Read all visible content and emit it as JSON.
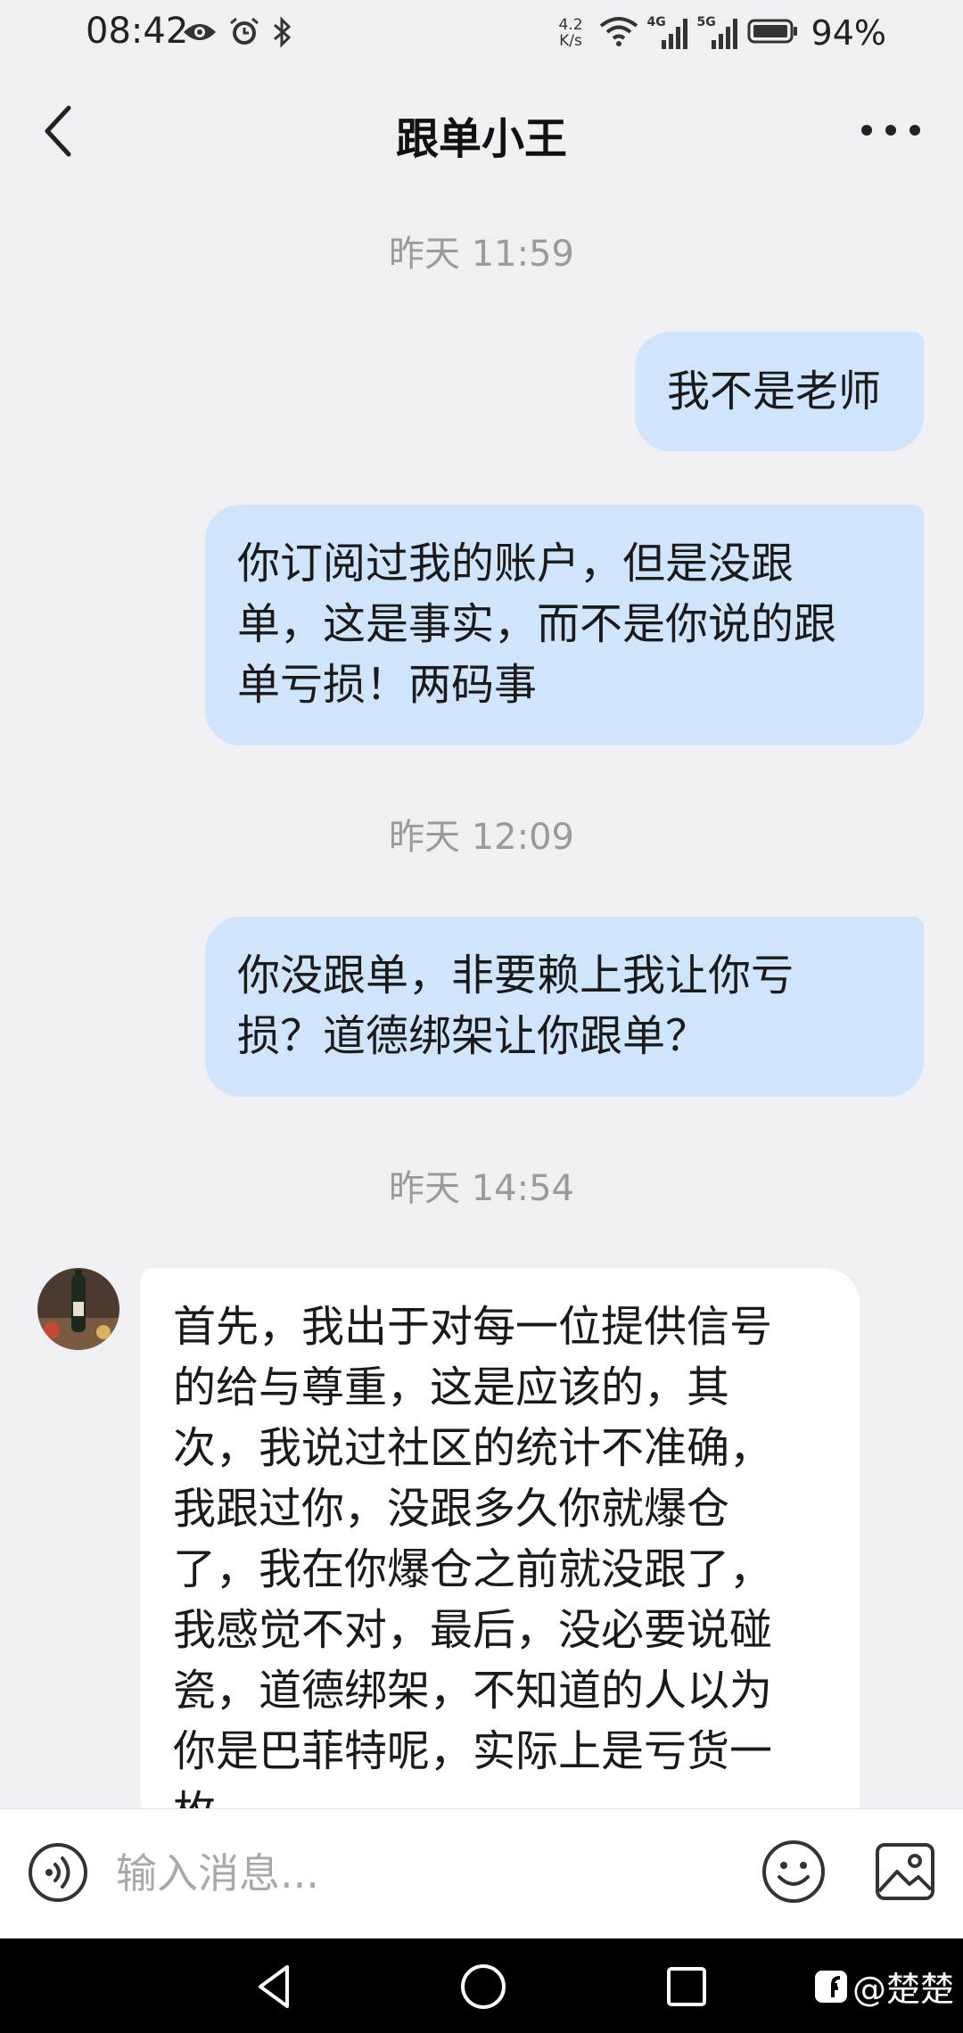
{
  "status_bar": {
    "time": "08:42",
    "net_speed_value": "4.2",
    "net_speed_unit": "K/s",
    "net_4g": "4G",
    "net_5g": "5G",
    "battery": "94%",
    "icons": [
      "eye-icon",
      "alarm-icon",
      "bluetooth-icon",
      "wifi-icon",
      "signal-icon",
      "battery-icon"
    ]
  },
  "header": {
    "title": "跟单小王",
    "icons": [
      "back-icon",
      "more-icon"
    ]
  },
  "messages": [
    {
      "type": "timestamp",
      "text": "昨天 11:59"
    },
    {
      "type": "out",
      "lines": [
        "我不是老师"
      ]
    },
    {
      "type": "out",
      "lines": [
        "你订阅过我的账户，但是没跟",
        "单，这是事实，而不是你说的跟",
        "单亏损！两码事"
      ]
    },
    {
      "type": "timestamp",
      "text": "昨天 12:09"
    },
    {
      "type": "out",
      "lines": [
        "你没跟单，非要赖上我让你亏",
        "损？道德绑架让你跟单？"
      ]
    },
    {
      "type": "timestamp",
      "text": "昨天 14:54"
    },
    {
      "type": "in",
      "lines": [
        "首先，我出于对每一位提供信号",
        "的给与尊重，这是应该的，其",
        "次，我说过社区的统计不准确，",
        "我跟过你，没跟多久你就爆仓",
        "了，我在你爆仓之前就没跟了，",
        "我感觉不对，最后，没必要说碰",
        "瓷，道德绑架，不知道的人以为",
        "你是巴菲特呢，实际上是亏货一",
        "枚"
      ]
    }
  ],
  "input_bar": {
    "placeholder": "输入消息...",
    "icons": [
      "voice-icon",
      "emoji-icon",
      "image-icon"
    ]
  },
  "nav_bar": {
    "icons": [
      "nav-back-icon",
      "nav-home-icon",
      "nav-recent-icon"
    ],
    "watermark": "@楚楚"
  },
  "colors": {
    "background": "#f0f0f4",
    "outgoing_bubble": "#cfe5fc",
    "incoming_bubble": "#ffffff",
    "timestamp": "#9a9a9e"
  }
}
